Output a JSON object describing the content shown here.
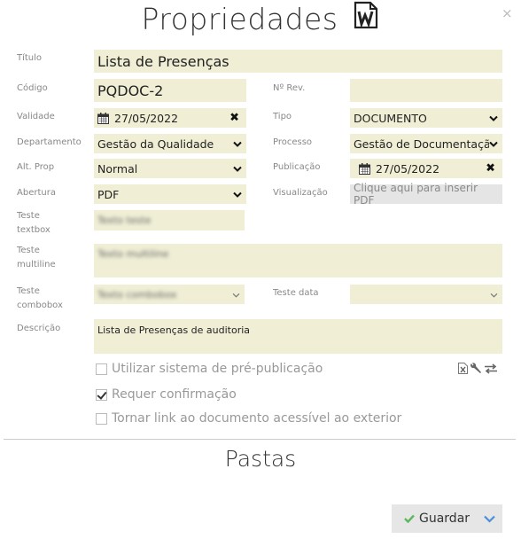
{
  "dialog": {
    "title": "Propriedades",
    "word_icon": "word-icon",
    "close_symbol": "×"
  },
  "fields": {
    "titulo": {
      "label": "Título",
      "value": "Lista de Presenças"
    },
    "codigo": {
      "label": "Código",
      "value": "PQDOC-2"
    },
    "nrev": {
      "label": "Nº Rev.",
      "value": ""
    },
    "validade": {
      "label": "Validade",
      "value": "27/05/2022"
    },
    "tipo": {
      "label": "Tipo",
      "value": "DOCUMENTO"
    },
    "departamento": {
      "label": "Departamento",
      "value": "Gestão da Qualidade"
    },
    "processo": {
      "label": "Processo",
      "value": "Gestão de Documentação"
    },
    "alt_prop": {
      "label": "Alt. Prop",
      "value": "Normal"
    },
    "publicacao": {
      "label": "Publicação",
      "value": "27/05/2022"
    },
    "abertura": {
      "label": "Abertura",
      "value": "PDF"
    },
    "visualizacao": {
      "label": "Visualização",
      "value": "Clique aqui para inserir PDF"
    },
    "teste_textbox": {
      "label1": "Teste",
      "label2": "textbox",
      "value": "Texto teste"
    },
    "teste_multiline": {
      "label1": "Teste",
      "label2": "multiline",
      "value": "Texto multiline"
    },
    "teste_combobox": {
      "label1": "Teste",
      "label2": "combobox",
      "value": "Texto combobox"
    },
    "teste_data": {
      "label": "Teste data",
      "value": ""
    },
    "descricao": {
      "label": "Descrição",
      "value": "Lista de Presenças de auditoria"
    }
  },
  "checkboxes": [
    {
      "label": "Utilizar sistema de pré-publicação",
      "checked": false
    },
    {
      "label": "Requer confirmação",
      "checked": true
    },
    {
      "label": "Tornar link ao documento acessível ao exterior",
      "checked": false
    }
  ],
  "tool_icons": [
    "excel-file-icon",
    "wrench-icon",
    "swap-arrows-icon"
  ],
  "section": {
    "title": "Pastas"
  },
  "footer": {
    "save_label": "Guardar"
  },
  "colors": {
    "field_bg": "#f0efd6",
    "save_check": "#5cb85c",
    "dropdown_arrow": "#4a90d9"
  }
}
